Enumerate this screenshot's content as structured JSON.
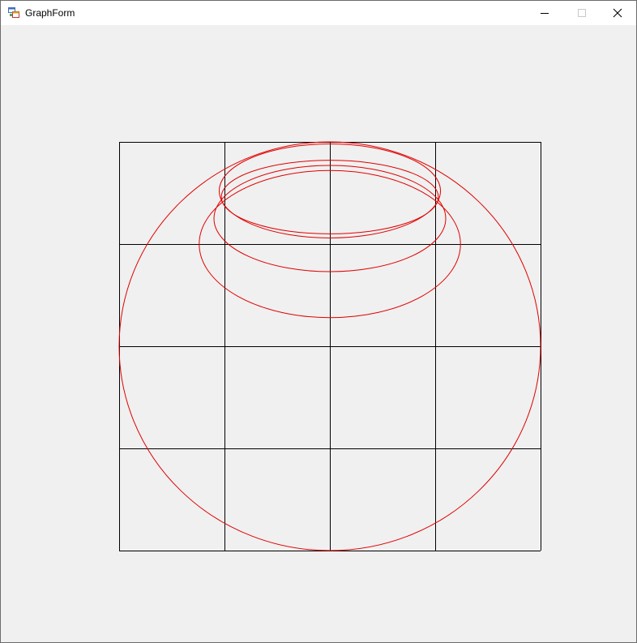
{
  "window": {
    "title": "GraphForm",
    "icon": "app-form-icon",
    "controls": {
      "minimize": "minimize-icon",
      "maximize": "maximize-icon",
      "close": "close-icon"
    }
  },
  "colors": {
    "background": "#f0f0f0",
    "titlebar": "#ffffff",
    "grid": "#000000",
    "curve": "#e00000"
  },
  "graph": {
    "grid": {
      "cols": 4,
      "rows": 4
    },
    "curves": [
      {
        "cx": 0,
        "cy": 0,
        "rx": 2,
        "ry": 2
      },
      {
        "cx": 0,
        "cy": 1.0,
        "rx": 1.24,
        "ry": 0.72
      },
      {
        "cx": 0,
        "cy": 1.25,
        "rx": 1.1,
        "ry": 0.52
      },
      {
        "cx": 0,
        "cy": 1.46,
        "rx": 1.03,
        "ry": 0.36
      },
      {
        "cx": 0,
        "cy": 1.52,
        "rx": 1.05,
        "ry": 0.46
      }
    ]
  }
}
